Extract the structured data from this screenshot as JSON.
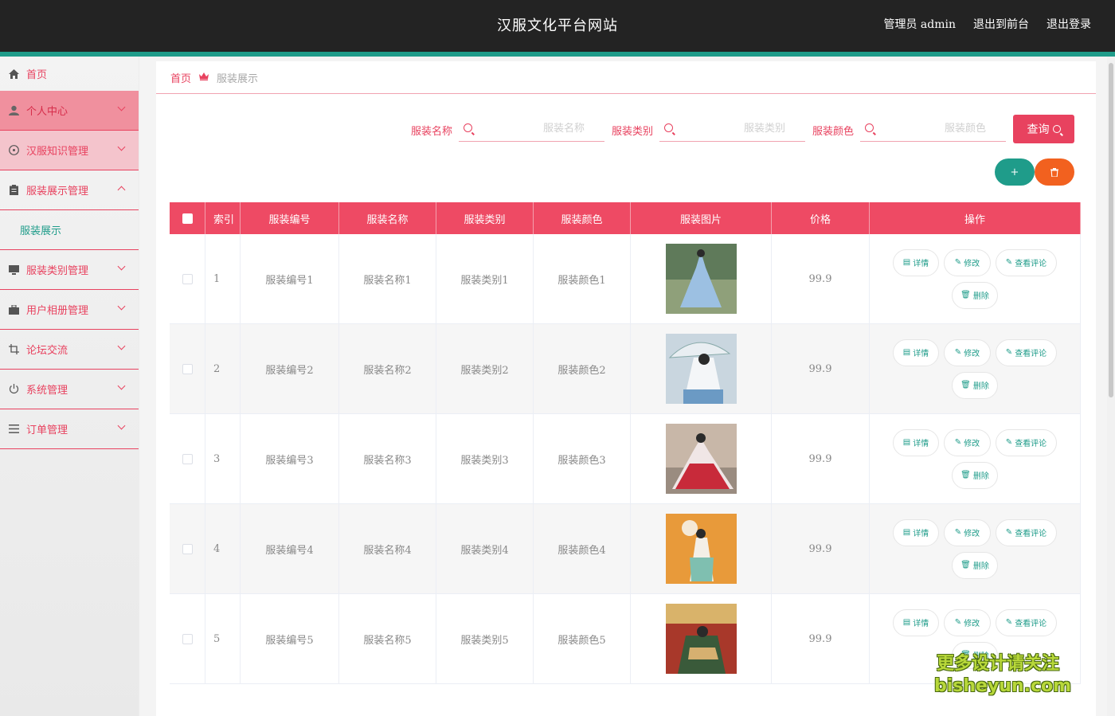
{
  "header": {
    "title": "汉服文化平台网站",
    "admin": "管理员 admin",
    "to_front": "退出到前台",
    "logout": "退出登录"
  },
  "sidebar": {
    "items": [
      {
        "label": "首页",
        "icon": "home-icon"
      },
      {
        "label": "个人中心",
        "icon": "user-icon"
      },
      {
        "label": "汉服知识管理",
        "icon": "compass-icon"
      },
      {
        "label": "服装展示管理",
        "icon": "clipboard-icon"
      },
      {
        "label": "服装类别管理",
        "icon": "monitor-icon"
      },
      {
        "label": "用户相册管理",
        "icon": "briefcase-icon"
      },
      {
        "label": "论坛交流",
        "icon": "crop-icon"
      },
      {
        "label": "系统管理",
        "icon": "power-icon"
      },
      {
        "label": "订单管理",
        "icon": "list-icon"
      }
    ],
    "submenu": "服装展示"
  },
  "breadcrumb": {
    "home": "首页",
    "current": "服装展示"
  },
  "search": {
    "name_label": "服装名称",
    "name_placeholder": "服装名称",
    "type_label": "服装类别",
    "type_placeholder": "服装类别",
    "color_label": "服装颜色",
    "color_placeholder": "服装颜色",
    "query": "查询"
  },
  "actions": {
    "add": "+",
    "delete": "🗑"
  },
  "table": {
    "headers": [
      "索引",
      "服装编号",
      "服装名称",
      "服装类别",
      "服装颜色",
      "服装图片",
      "价格",
      "操作"
    ],
    "ops": {
      "detail": "详情",
      "edit": "修改",
      "comments": "查看评论",
      "remove": "删除"
    },
    "rows": [
      {
        "index": "1",
        "code": "服装编号1",
        "name": "服装名称1",
        "type": "服装类别1",
        "color": "服装颜色1",
        "price": "99.9"
      },
      {
        "index": "2",
        "code": "服装编号2",
        "name": "服装名称2",
        "type": "服装类别2",
        "color": "服装颜色2",
        "price": "99.9"
      },
      {
        "index": "3",
        "code": "服装编号3",
        "name": "服装名称3",
        "type": "服装类别3",
        "color": "服装颜色3",
        "price": "99.9"
      },
      {
        "index": "4",
        "code": "服装编号4",
        "name": "服装名称4",
        "type": "服装类别4",
        "color": "服装颜色4",
        "price": "99.9"
      },
      {
        "index": "5",
        "code": "服装编号5",
        "name": "服装名称5",
        "type": "服装类别5",
        "color": "服装颜色5",
        "price": "99.9"
      }
    ]
  },
  "watermark": {
    "line1": "更多设计请关注",
    "line2": "bisheyun.com"
  },
  "colors": {
    "primary": "#e8425f",
    "teal": "#1f9c8a",
    "orange": "#f2611f",
    "header_bg": "#232323"
  }
}
